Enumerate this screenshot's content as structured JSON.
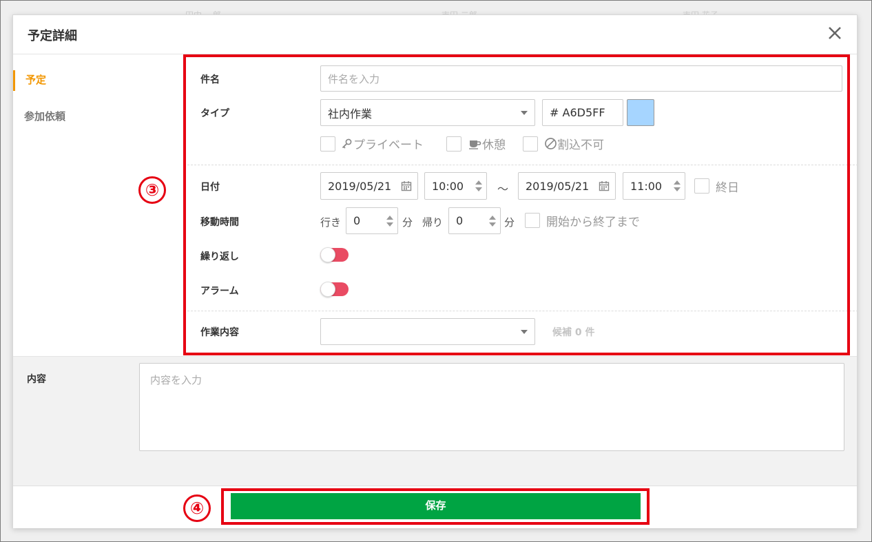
{
  "background": {
    "faint_texts": [
      "田中 一郎",
      "吉田 二郎",
      "吉田 花子"
    ]
  },
  "modal": {
    "title": "予定詳細",
    "close_symbol": "✕"
  },
  "sidebar": {
    "items": [
      {
        "label": "予定",
        "active": true
      },
      {
        "label": "参加依頼",
        "active": false
      }
    ]
  },
  "form": {
    "subject": {
      "label": "件名",
      "placeholder": "件名を入力",
      "value": ""
    },
    "type": {
      "label": "タイプ",
      "selected": "社内作業",
      "color_code": "# A6D5FF",
      "color": "#a6d5ff",
      "options": [
        {
          "icon": "key-icon",
          "label": "プライベート",
          "checked": false
        },
        {
          "icon": "cup-icon",
          "label": "休憩",
          "checked": false
        },
        {
          "icon": "no-entry-icon",
          "label": "割込不可",
          "checked": false
        }
      ]
    },
    "date": {
      "label": "日付",
      "start_date": "2019/05/21",
      "start_time": "10:00",
      "separator": "～",
      "end_date": "2019/05/21",
      "end_time": "11:00",
      "all_day_label": "終日"
    },
    "travel": {
      "label": "移動時間",
      "go_label": "行き",
      "go_value": "0",
      "go_unit": "分",
      "return_label": "帰り",
      "return_value": "0",
      "return_unit": "分",
      "start_to_end_label": "開始から終了まで"
    },
    "repeat": {
      "label": "繰り返し",
      "on": true
    },
    "alarm": {
      "label": "アラーム",
      "on": true
    },
    "work": {
      "label": "作業内容",
      "selected": "",
      "candidates_text": "候補 0 件"
    }
  },
  "content": {
    "label": "内容",
    "placeholder": "内容を入力"
  },
  "footer": {
    "save_label": "保存"
  },
  "annotations": {
    "callout_3": "③",
    "callout_4": "④",
    "accent_color": "#e60012"
  },
  "colors": {
    "active_tab": "#f29600",
    "save_button": "#00a443",
    "toggle": "#e94b63"
  }
}
